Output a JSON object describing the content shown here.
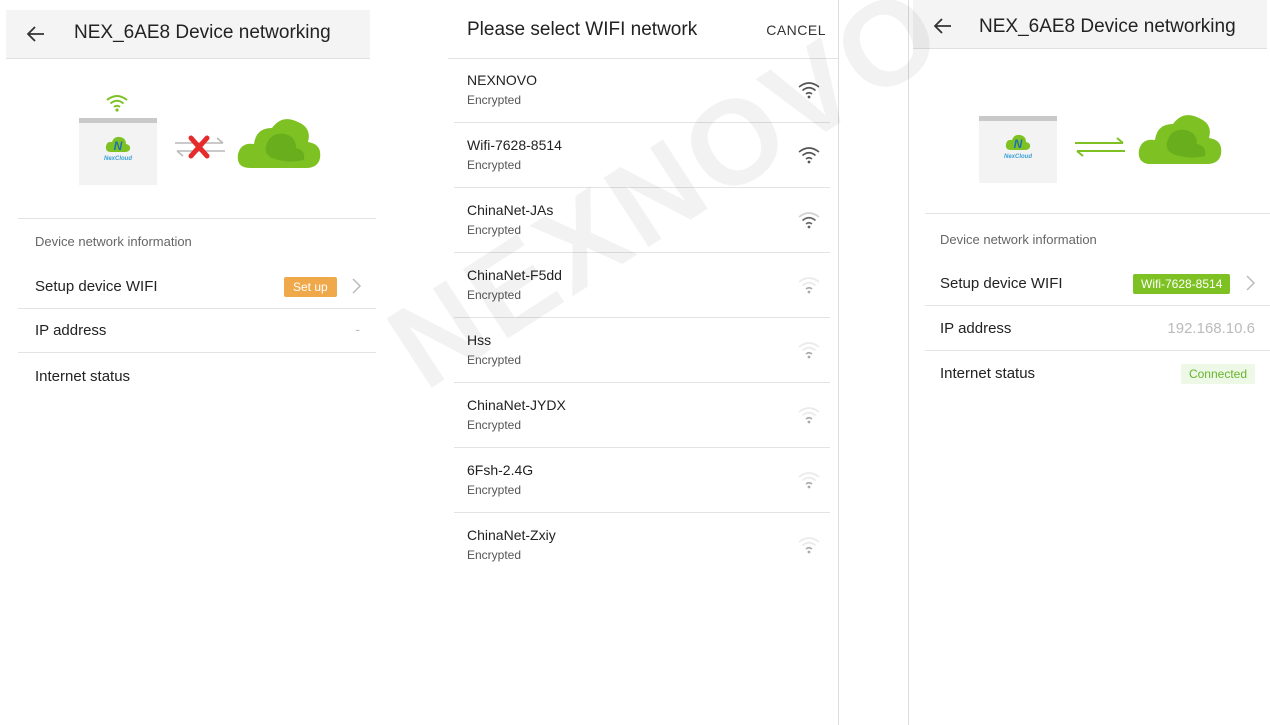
{
  "panel1": {
    "title": "NEX_6AE8 Device networking",
    "device_logo_letter": "N",
    "device_logo_text": "NexCloud",
    "section_label": "Device network information",
    "rows": {
      "wifi": {
        "label": "Setup device WIFI",
        "badge": "Set up"
      },
      "ip": {
        "label": "IP address",
        "value": "-"
      },
      "internet": {
        "label": "Internet status"
      }
    }
  },
  "panel2": {
    "title": "Please select WIFI network",
    "cancel_label": "CANCEL",
    "networks": [
      {
        "name": "NEXNOVO",
        "security": "Encrypted",
        "signal": "strong"
      },
      {
        "name": "Wifi-7628-8514",
        "security": "Encrypted",
        "signal": "strong"
      },
      {
        "name": "ChinaNet-JAs",
        "security": "Encrypted",
        "signal": "medium"
      },
      {
        "name": "ChinaNet-F5dd",
        "security": "Encrypted",
        "signal": "weak"
      },
      {
        "name": "Hss",
        "security": "Encrypted",
        "signal": "weak"
      },
      {
        "name": "ChinaNet-JYDX",
        "security": "Encrypted",
        "signal": "weak"
      },
      {
        "name": "6Fsh-2.4G",
        "security": "Encrypted",
        "signal": "weak"
      },
      {
        "name": "ChinaNet-Zxiy",
        "security": "Encrypted",
        "signal": "weak"
      }
    ]
  },
  "panel3": {
    "title": "NEX_6AE8 Device networking",
    "device_logo_letter": "N",
    "device_logo_text": "NexCloud",
    "section_label": "Device network information",
    "rows": {
      "wifi": {
        "label": "Setup device WIFI",
        "badge": "Wifi-7628-8514"
      },
      "ip": {
        "label": "IP address",
        "value": "192.168.10.6"
      },
      "internet": {
        "label": "Internet status",
        "badge": "Connected"
      }
    }
  },
  "watermark": "NEXNOVO",
  "colors": {
    "brand_green": "#7dc222",
    "badge_orange": "#f0a94a",
    "error_red": "#e52b2b",
    "connected_text": "#67b52d"
  }
}
